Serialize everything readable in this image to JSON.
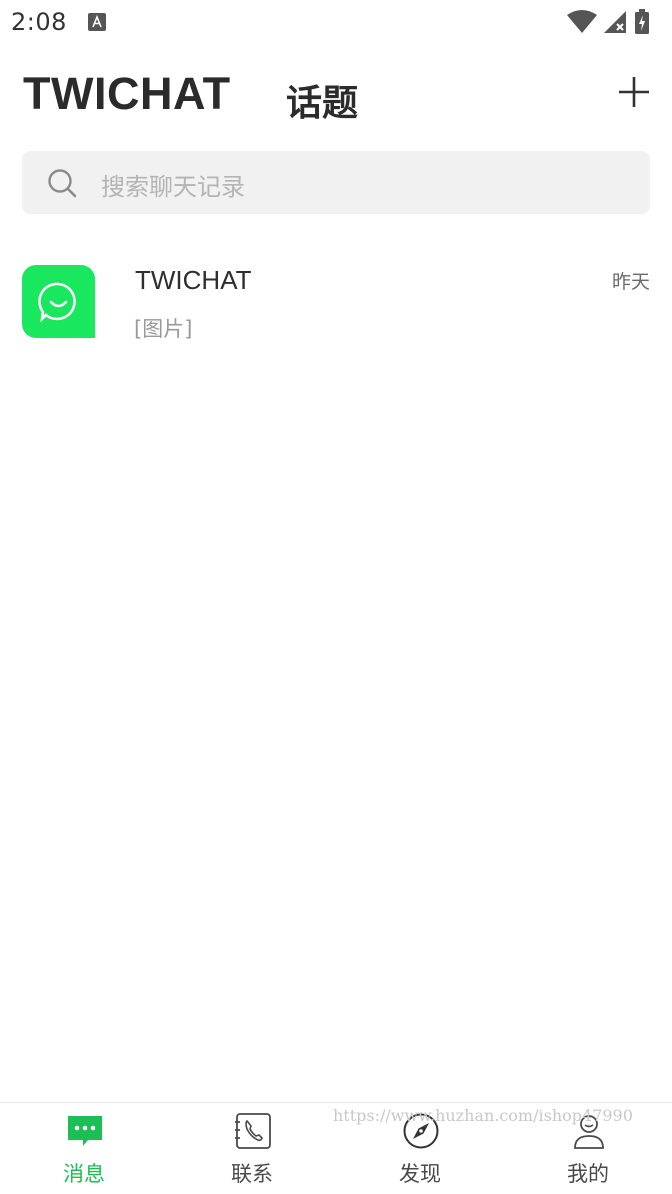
{
  "status_bar": {
    "time": "2:08",
    "icons": [
      "a-icon",
      "wifi-icon",
      "signal-icon",
      "battery-icon"
    ]
  },
  "header": {
    "app_title": "TWICHAT",
    "topic_title": "话题",
    "add_icon": "plus-icon"
  },
  "search": {
    "placeholder": "搜索聊天记录",
    "icon": "search-icon"
  },
  "chats": [
    {
      "name": "TWICHAT",
      "preview": "[图片]",
      "time": "昨天",
      "avatar_color": "#19e85f"
    }
  ],
  "bottom_nav": {
    "items": [
      {
        "label": "消息",
        "icon": "message-icon",
        "active": true
      },
      {
        "label": "联系",
        "icon": "contacts-icon",
        "active": false
      },
      {
        "label": "发现",
        "icon": "compass-icon",
        "active": false
      },
      {
        "label": "我的",
        "icon": "profile-icon",
        "active": false
      }
    ]
  },
  "watermark": "https://www.huzhan.com/ishop47990",
  "colors": {
    "accent": "#1bbf55",
    "avatar": "#19e85f",
    "search_bg": "#f1f1f1"
  }
}
